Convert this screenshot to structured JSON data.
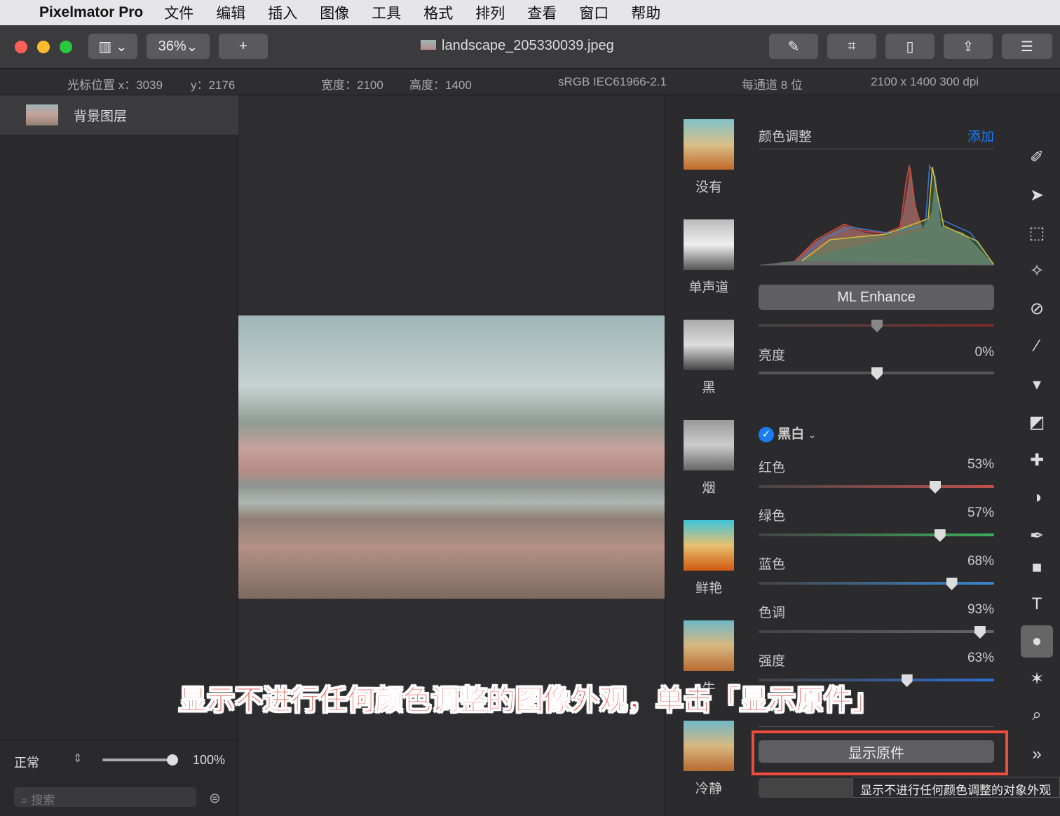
{
  "menubar": {
    "app": "Pixelmator Pro",
    "items": [
      "文件",
      "编辑",
      "插入",
      "图像",
      "工具",
      "格式",
      "排列",
      "查看",
      "窗口",
      "帮助"
    ]
  },
  "toolbar": {
    "zoom": "36%",
    "add": "+",
    "title": "landscape_205330039.jpeg"
  },
  "info": {
    "cursor_x": "光标位置 x：3039",
    "cursor_y": "y：2176",
    "width": "宽度：2100",
    "height": "高度：1400",
    "profile": "sRGB IEC61966-2.1",
    "depth": "每通道 8 位",
    "size": "2100 x 1400 300 dpi"
  },
  "layers": {
    "items": [
      {
        "name": "背景图层"
      }
    ],
    "blend_mode": "正常",
    "opacity": "100%",
    "search_placeholder": "搜索"
  },
  "presets": [
    "没有",
    "单声道",
    "黑",
    "烟",
    "鲜艳",
    "牛",
    "冷静"
  ],
  "adjustments": {
    "title": "颜色调整",
    "add": "添加",
    "ml_enhance": "ML Enhance",
    "brightness": {
      "label": "亮度",
      "value": "0%",
      "level": 0.5
    },
    "bw": {
      "label": "黑白",
      "checked": true
    },
    "sliders": [
      {
        "label": "红色",
        "value": "53%",
        "level": 0.75,
        "color": "#c0504d"
      },
      {
        "label": "绿色",
        "value": "57%",
        "level": 0.77,
        "color": "#3cae5a"
      },
      {
        "label": "蓝色",
        "value": "68%",
        "level": 0.82,
        "color": "#3a86d0"
      },
      {
        "label": "色调",
        "value": "93%",
        "level": 0.94,
        "color": "#666"
      },
      {
        "label": "强度",
        "value": "63%",
        "level": 0.63,
        "color": "#2f6fd6"
      }
    ],
    "show_original": "显示原件"
  },
  "tooltip": "显示不进行任何颜色调整的对象外观",
  "caption": "显示不进行任何颜色调整的图像外观，单击「显示原件」",
  "colors": {
    "accent": "#1a7cf5",
    "highlight": "#e8392e"
  }
}
